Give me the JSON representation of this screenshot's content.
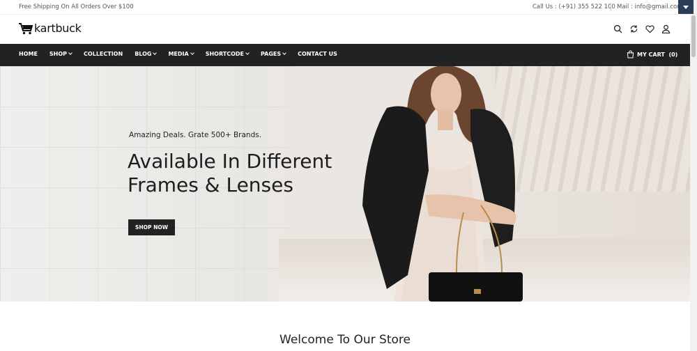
{
  "topbar": {
    "shipping": "Free Shipping On All Orders Over $100",
    "call": "Call Us : (+91) 355 522 100",
    "mail": "Mail : info@gmail.com"
  },
  "brand": {
    "name": "kartbuck"
  },
  "icons": [
    "search-icon",
    "compare-icon",
    "heart-icon",
    "user-icon",
    "cart-icon"
  ],
  "nav": {
    "items": [
      {
        "label": "HOME",
        "dropdown": false
      },
      {
        "label": "SHOP",
        "dropdown": true
      },
      {
        "label": "COLLECTION",
        "dropdown": false
      },
      {
        "label": "BLOG",
        "dropdown": true
      },
      {
        "label": "MEDIA",
        "dropdown": true
      },
      {
        "label": "SHORTCODE",
        "dropdown": true
      },
      {
        "label": "PAGES",
        "dropdown": true
      },
      {
        "label": "CONTACT US",
        "dropdown": false
      }
    ],
    "cart_label": "MY CART",
    "cart_count": "(0)"
  },
  "hero": {
    "tagline": "Amazing Deals. Grate 500+ Brands.",
    "title_line1": "Available In Different",
    "title_line2": "Frames & Lenses",
    "button": "SHOP NOW"
  },
  "welcome": {
    "title": "Welcome To Our Store"
  },
  "colors": {
    "nav_bg": "#222222",
    "button_bg": "#222222",
    "accent": "#2c3e57"
  }
}
